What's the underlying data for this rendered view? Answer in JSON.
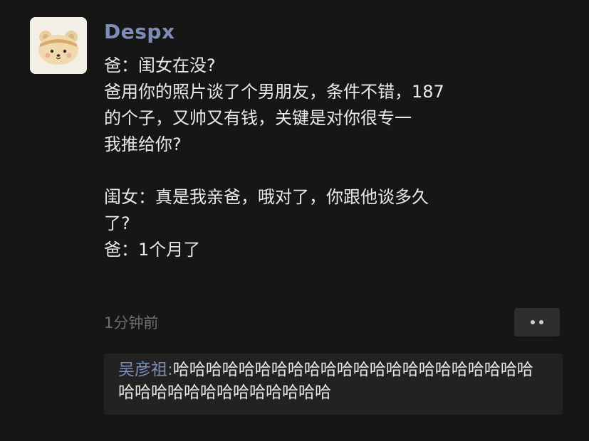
{
  "post": {
    "username": "Despx",
    "message_lines": [
      "爸：闺女在没?",
      "爸用你的照片谈了个男朋友，条件不错，187",
      "的个子，又帅又有钱，关键是对你很专一",
      "我推给你?",
      "",
      "闺女：真是我亲爸，哦对了，你跟他谈多久",
      "了?",
      "爸：1个月了"
    ],
    "timestamp": "1分钟前",
    "more_icon": "more-dots-icon"
  },
  "comments": [
    {
      "author": "吴彦祖:",
      "text": "哈哈哈哈哈哈哈哈哈哈哈哈哈哈哈哈哈哈哈哈哈哈哈哈哈哈哈哈哈哈哈哈哈哈哈"
    }
  ],
  "colors": {
    "background": "#161616",
    "username": "#7d8db8",
    "text": "#e9e9e9",
    "timestamp": "#6e6e6e",
    "comment_bg": "#222222"
  },
  "avatar_icon": "bear-avatar-icon"
}
